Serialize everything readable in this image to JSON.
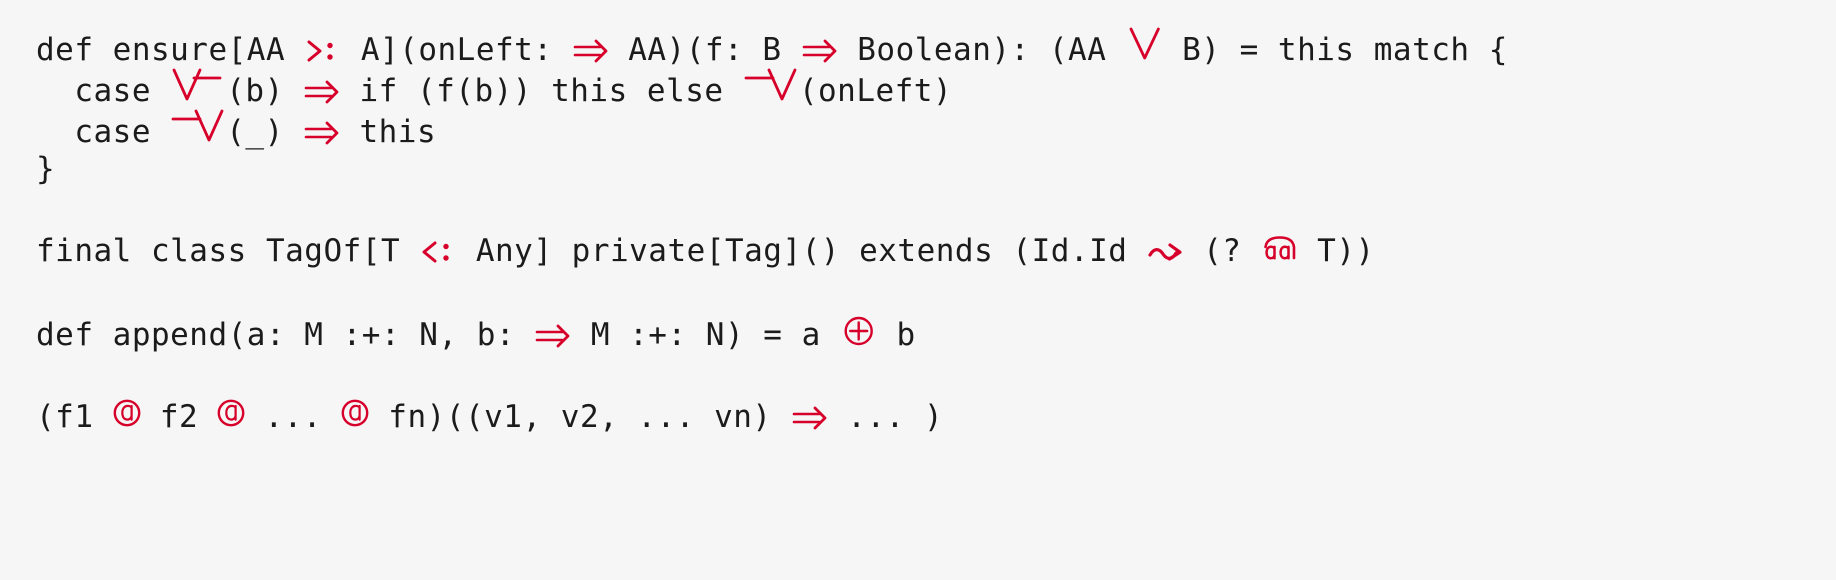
{
  "document": {
    "kind": "code-sample",
    "language": "Scala",
    "background_color": "#f6f6f6",
    "text_color": "#1b1b1b",
    "ligature_color": "#d6002a",
    "font_size_px": 31
  },
  "code": {
    "plain_text": "def ensure[AA >: A](onLeft: ⇒ AA)(f: B ⇒ Boolean): (AA \\/ B) = this match {\n  case \\/-(b) ⇒ if (f(b)) this else -\\/(onLeft)\n  case -\\/(_) ⇒ this\n}\n\nfinal class TagOf[T <: Any] private[Tag]() extends (Id.Id ~> (? @@ T))\n\ndef append(a: M :+: N, b: ⇒ M :+: N) = a |+| b\n\n(f1 @ f2 @ ... @ fn)((v1, v2, ... vn) ⇒ ... )",
    "lines": [
      {
        "id": "line-1",
        "indent": 0,
        "tokens": [
          {
            "t": "text",
            "v": "def ensure[AA "
          },
          {
            "t": "lig",
            "v": ">:",
            "glyph": "greater-colon-ligature"
          },
          {
            "t": "text",
            "v": " A](onLeft: "
          },
          {
            "t": "lig",
            "v": "=>",
            "glyph": "double-arrow-right-ligature"
          },
          {
            "t": "text",
            "v": " AA)(f: B "
          },
          {
            "t": "lig",
            "v": "=>",
            "glyph": "double-arrow-right-ligature"
          },
          {
            "t": "text",
            "v": " Boolean): (AA "
          },
          {
            "t": "lig",
            "v": "\\/",
            "glyph": "logical-or-ligature"
          },
          {
            "t": "text",
            "v": " B) = this match {"
          }
        ]
      },
      {
        "id": "line-2",
        "indent": 2,
        "tokens": [
          {
            "t": "text",
            "v": "  case "
          },
          {
            "t": "lig",
            "v": "\\/-",
            "glyph": "right-disjunction-ligature"
          },
          {
            "t": "text",
            "v": "(b) "
          },
          {
            "t": "lig",
            "v": "=>",
            "glyph": "double-arrow-right-ligature"
          },
          {
            "t": "text",
            "v": " if (f(b)) this else "
          },
          {
            "t": "lig",
            "v": "-\\/",
            "glyph": "left-disjunction-ligature"
          },
          {
            "t": "text",
            "v": "(onLeft)"
          }
        ]
      },
      {
        "id": "line-3",
        "indent": 2,
        "tokens": [
          {
            "t": "text",
            "v": "  case "
          },
          {
            "t": "lig",
            "v": "-\\/",
            "glyph": "left-disjunction-ligature"
          },
          {
            "t": "text",
            "v": "(_) "
          },
          {
            "t": "lig",
            "v": "=>",
            "glyph": "double-arrow-right-ligature"
          },
          {
            "t": "text",
            "v": " this"
          }
        ]
      },
      {
        "id": "line-4",
        "indent": 0,
        "tokens": [
          {
            "t": "text",
            "v": "}"
          }
        ]
      },
      {
        "id": "line-5",
        "blank": true,
        "tokens": []
      },
      {
        "id": "line-6",
        "indent": 0,
        "tokens": [
          {
            "t": "text",
            "v": "final class TagOf[T "
          },
          {
            "t": "lig",
            "v": "<:",
            "glyph": "less-colon-ligature"
          },
          {
            "t": "text",
            "v": " Any] private[Tag]() extends (Id.Id "
          },
          {
            "t": "lig",
            "v": "~>",
            "glyph": "squiggly-arrow-ligature"
          },
          {
            "t": "text",
            "v": " (? "
          },
          {
            "t": "lig",
            "v": "@@",
            "glyph": "tagged-type-ligature"
          },
          {
            "t": "text",
            "v": " T))"
          }
        ]
      },
      {
        "id": "line-7",
        "blank": true,
        "tokens": []
      },
      {
        "id": "line-8",
        "indent": 0,
        "tokens": [
          {
            "t": "text",
            "v": "def append(a: M :+: N, b: "
          },
          {
            "t": "lig",
            "v": "=>",
            "glyph": "double-arrow-right-ligature"
          },
          {
            "t": "text",
            "v": " M :+: N) = a "
          },
          {
            "t": "lig",
            "v": "|+|",
            "glyph": "circled-plus-ligature"
          },
          {
            "t": "text",
            "v": " b"
          }
        ]
      },
      {
        "id": "line-9",
        "blank": true,
        "tokens": []
      },
      {
        "id": "line-10",
        "indent": 0,
        "tokens": [
          {
            "t": "text",
            "v": "(f1 "
          },
          {
            "t": "lig",
            "v": "@",
            "glyph": "circled-at-ligature"
          },
          {
            "t": "text",
            "v": " f2 "
          },
          {
            "t": "lig",
            "v": "@",
            "glyph": "circled-at-ligature"
          },
          {
            "t": "text",
            "v": " ... "
          },
          {
            "t": "lig",
            "v": "@",
            "glyph": "circled-at-ligature"
          },
          {
            "t": "text",
            "v": " fn)((v1, v2, ... vn) "
          },
          {
            "t": "lig",
            "v": "=>",
            "glyph": "double-arrow-right-ligature"
          },
          {
            "t": "text",
            "v": " ... )"
          }
        ]
      }
    ]
  },
  "ligature_glyphs": {
    "double-arrow-right-ligature": {
      "source": "=>",
      "meaning": "function arrow (double-stroke right arrow)"
    },
    "greater-colon-ligature": {
      "source": ">:",
      "meaning": "lower type bound"
    },
    "less-colon-ligature": {
      "source": "<:",
      "meaning": "upper type bound"
    },
    "logical-or-ligature": {
      "source": "\\/",
      "meaning": "scalaz disjunction (large V)"
    },
    "right-disjunction-ligature": {
      "source": "\\/-",
      "meaning": "right projection (V with right bar)"
    },
    "left-disjunction-ligature": {
      "source": "-\\/",
      "meaning": "left projection (bar then V)"
    },
    "squiggly-arrow-ligature": {
      "source": "~>",
      "meaning": "natural transformation"
    },
    "tagged-type-ligature": {
      "source": "@@",
      "meaning": "tagged type (double-a under shared arc)"
    },
    "circled-plus-ligature": {
      "source": "|+|",
      "meaning": "semigroup append (circled plus)"
    },
    "circled-at-ligature": {
      "source": "@",
      "meaning": "at-sign (circled a)"
    }
  }
}
